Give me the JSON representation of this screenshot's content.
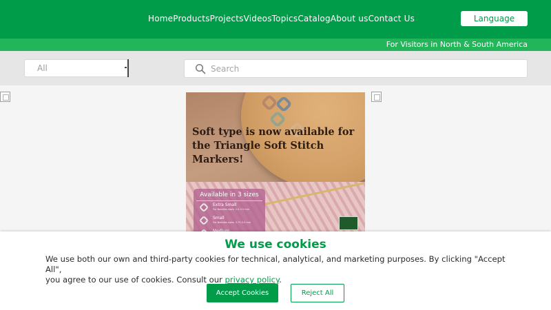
{
  "header": {
    "nav": [
      "Home",
      "Products",
      "Projects",
      "Videos",
      "Topics",
      "Catalog",
      "About us",
      "Contact Us"
    ],
    "language_label": "Language"
  },
  "region_notice": "For Visitors in North & South America",
  "search": {
    "category_value": "All",
    "placeholder": "Search"
  },
  "banner": {
    "headline": "Soft type is now available for the Triangle Soft Stitch Markers!",
    "sizes_title": "Available in 3 sizes",
    "sizes": [
      {
        "name": "Extra Small",
        "sub": "For Needles sizes: 2.0-3.5 mm"
      },
      {
        "name": "Small",
        "sub": "For Needles sizes: 3.75-5.0 mm"
      },
      {
        "name": "Medium",
        "sub": ""
      }
    ]
  },
  "cookie_banner": {
    "title": "We use cookies",
    "text_line1": "We use both our own and third-party cookies for technical, analytical, and marketing purposes. By clicking \"Accept All\",",
    "text_line2_pre": "you agree to our use of cookies. Consult our ",
    "link_text": "privacy policy",
    "text_line2_post": ".",
    "accept_label": "Accept Cookies",
    "reject_label": "Reject All"
  },
  "colors": {
    "brand_green": "#019c49",
    "region_bar": "#22b55a",
    "search_row_bg": "#e6e6e6"
  },
  "icons": [
    "search-icon",
    "broken-image-icon"
  ]
}
